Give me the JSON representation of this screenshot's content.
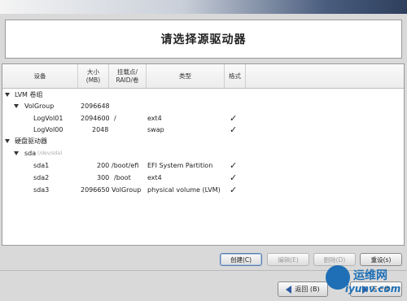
{
  "title": "请选择源驱动器",
  "columns": {
    "device": "设备",
    "size": "大小\n(MB)",
    "mount": "挂载点/\nRAID/卷",
    "type": "类型",
    "format": "格式"
  },
  "rows": {
    "lvm": {
      "device": "LVM 卷组"
    },
    "volgroup": {
      "device": "VolGroup",
      "size": "2096648"
    },
    "logvol01": {
      "device": "LogVol01",
      "size": "2094600",
      "mount": "/",
      "type": "ext4",
      "format": "✓"
    },
    "logvol00": {
      "device": "LogVol00",
      "size": "2048",
      "mount": "",
      "type": "swap",
      "format": "✓"
    },
    "hdd": {
      "device": "硬盘驱动器"
    },
    "sda": {
      "device": "sda",
      "path": "(/dev/sda)"
    },
    "sda1": {
      "device": "sda1",
      "size": "200",
      "mount": "/boot/efi",
      "type": "EFI System Partition",
      "format": "✓"
    },
    "sda2": {
      "device": "sda2",
      "size": "300",
      "mount": "/boot",
      "type": "ext4",
      "format": "✓"
    },
    "sda3": {
      "device": "sda3",
      "size": "2096650",
      "mount": "VolGroup",
      "type": "physical volume (LVM)",
      "format": "✓"
    }
  },
  "buttons": {
    "create": "创建(C)",
    "edit": "编辑(E)",
    "delete": "删除(D)",
    "reset": "重设(s)",
    "back": "返回 (B)",
    "next": "下一步"
  },
  "watermark": {
    "line1": "运维网",
    "line2": "iyunv.com"
  },
  "colors": {
    "accent": "#2d5aa0",
    "watermark": "#1e6fb5"
  }
}
